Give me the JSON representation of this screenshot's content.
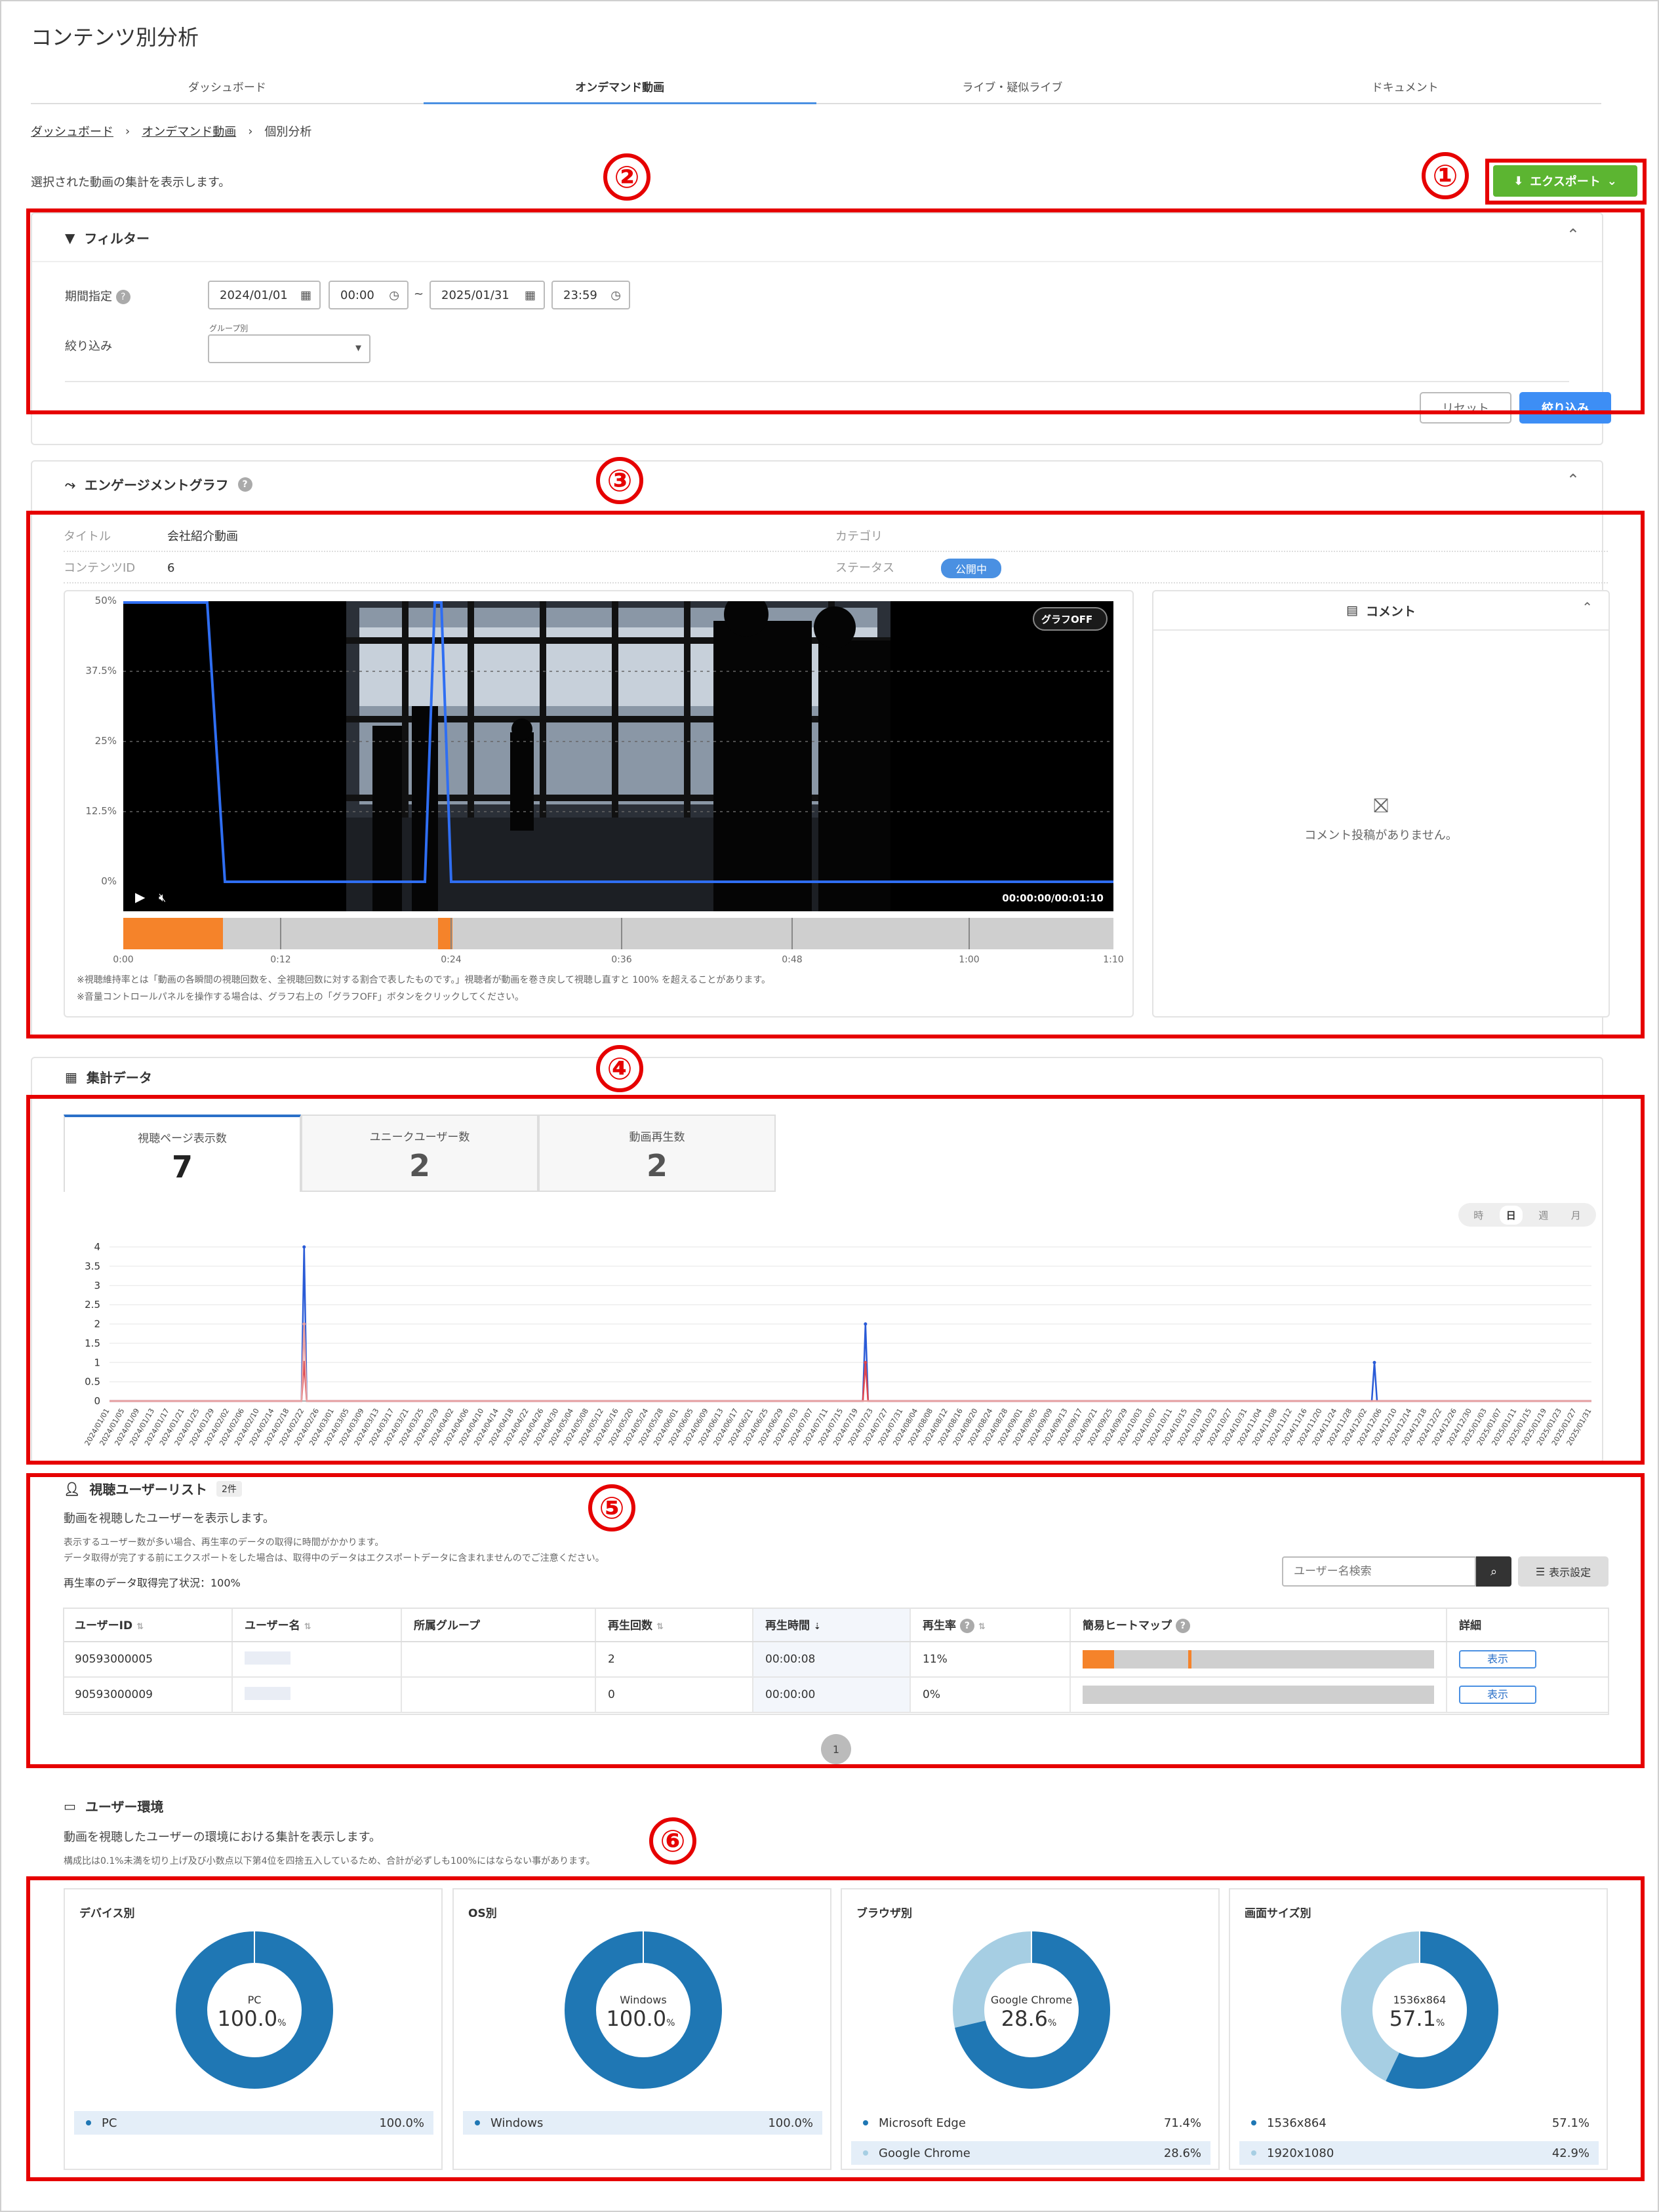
{
  "page": {
    "title": "コンテンツ別分析",
    "description": "選択された動画の集計を表示します。"
  },
  "tabs": [
    {
      "label": "ダッシュボード"
    },
    {
      "label": "オンデマンド動画"
    },
    {
      "label": "ライブ・疑似ライブ"
    },
    {
      "label": "ドキュメント"
    }
  ],
  "breadcrumb": [
    {
      "label": "ダッシュボード"
    },
    {
      "label": "オンデマンド動画"
    },
    {
      "label": "個別分析"
    }
  ],
  "export": {
    "label": "エクスポート"
  },
  "callouts": [
    "①",
    "②",
    "③",
    "④",
    "⑤",
    "⑥"
  ],
  "filter": {
    "title": "フィルター",
    "period_label": "期間指定",
    "start_date": "2024/01/01",
    "start_time": "00:00",
    "tilde": "~",
    "end_date": "2025/01/31",
    "end_time": "23:59",
    "refine_label": "絞り込み",
    "group_label": "グループ別",
    "reset": "リセット",
    "apply": "絞り込み"
  },
  "engagement": {
    "title": "エンゲージメントグラフ",
    "title_key": "タイトル",
    "title_val": "会社紹介動画",
    "category_key": "カテゴリ",
    "id_key": "コンテンツID",
    "id_val": "6",
    "status_key": "ステータス",
    "status_val": "公開中",
    "graph_off": "グラフOFF",
    "time": "00:00:00/00:01:10",
    "yticks": [
      "50%",
      "37.5%",
      "25%",
      "12.5%",
      "0%"
    ],
    "xticks": [
      "0:00",
      "0:12",
      "0:24",
      "0:36",
      "0:48",
      "1:00",
      "1:10"
    ],
    "note1": "※視聴維持率とは「動画の各瞬間の視聴回数を、全視聴回数に対する割合で表したものです。」視聴者が動画を巻き戻して視聴し直すと 100% を超えることがあります。",
    "note2": "※音量コントロールパネルを操作する場合は、グラフ右上の「グラフOFF」ボタンをクリックしてください。",
    "comment_title": "コメント",
    "no_comment": "コメント投稿がありません。"
  },
  "summary": {
    "title": "集計データ",
    "kpis": [
      {
        "label": "視聴ページ表示数",
        "value": "7"
      },
      {
        "label": "ユニークユーザー数",
        "value": "2"
      },
      {
        "label": "動画再生数",
        "value": "2"
      }
    ],
    "intervals": [
      "時",
      "日",
      "週",
      "月"
    ],
    "active_interval": "日"
  },
  "chart_data": {
    "type": "line",
    "ylim": [
      0,
      4
    ],
    "yticks": [
      "4",
      "3.5",
      "3",
      "2.5",
      "2",
      "1.5",
      "1",
      "0.5",
      "0"
    ],
    "x_start": "2024/01/01",
    "x_end": "2025/01/31",
    "x_tick_every_days": 4,
    "series": [
      {
        "color": "#2a5bd7",
        "points": [
          [
            "2024/02/22",
            4
          ],
          [
            "2024/07/21",
            2
          ],
          [
            "2024/12/04",
            1
          ]
        ]
      },
      {
        "color": "#e0464e",
        "points": [
          [
            "2024/02/22",
            1
          ],
          [
            "2024/07/21",
            1
          ]
        ]
      },
      {
        "color": "#e8a0a0",
        "points": [
          [
            "2024/02/22",
            2
          ]
        ]
      }
    ]
  },
  "userlist": {
    "title": "視聴ユーザーリスト",
    "count": "2件",
    "subtitle": "動画を視聴したユーザーを表示します。",
    "note1": "表示するユーザー数が多い場合、再生率のデータの取得に時間がかかります。",
    "note2": "データ取得が完了する前にエクスポートをした場合は、取得中のデータはエクスポートデータに含まれませんのでご注意ください。",
    "status": "再生率のデータ取得完了状況：100%",
    "search_placeholder": "ユーザー名検索",
    "display_settings": "表示設定",
    "columns": [
      "ユーザーID",
      "ユーザー名",
      "所属グループ",
      "再生回数",
      "再生時間",
      "再生率",
      "簡易ヒートマップ",
      "詳細"
    ],
    "rows": [
      {
        "id": "90593000005",
        "name": "",
        "group": "",
        "count": "2",
        "time": "00:00:08",
        "rate": "11%",
        "view": "表示",
        "heat": [
          [
            0,
            0.09
          ],
          [
            0.3,
            0.31
          ]
        ]
      },
      {
        "id": "90593000009",
        "name": "",
        "group": "",
        "count": "0",
        "time": "00:00:00",
        "rate": "0%",
        "view": "表示",
        "heat": []
      }
    ],
    "page": "1"
  },
  "environment": {
    "title": "ユーザー環境",
    "subtitle": "動画を視聴したユーザーの環境における集計を表示します。",
    "note": "構成比は0.1%未満を切り上げ及び小数点以下第4位を四捨五入しているため、合計が必ずしも100%にはならない事があります。",
    "charts": [
      {
        "title": "デバイス別",
        "center_label": "PC",
        "center_value": "100.0",
        "slices": [
          {
            "label": "PC",
            "value": 100.0,
            "pct": "100.0%",
            "color": "#1f77b4"
          }
        ]
      },
      {
        "title": "OS別",
        "center_label": "Windows",
        "center_value": "100.0",
        "slices": [
          {
            "label": "Windows",
            "value": 100.0,
            "pct": "100.0%",
            "color": "#1f77b4"
          }
        ]
      },
      {
        "title": "ブラウザ別",
        "center_label": "Google Chrome",
        "center_value": "28.6",
        "slices": [
          {
            "label": "Microsoft Edge",
            "value": 71.4,
            "pct": "71.4%",
            "color": "#1f77b4"
          },
          {
            "label": "Google Chrome",
            "value": 28.6,
            "pct": "28.6%",
            "color": "#a6cee3"
          }
        ]
      },
      {
        "title": "画面サイズ別",
        "center_label": "1536x864",
        "center_value": "57.1",
        "slices": [
          {
            "label": "1536x864",
            "value": 57.1,
            "pct": "57.1%",
            "color": "#1f77b4"
          },
          {
            "label": "1920x1080",
            "value": 42.9,
            "pct": "42.9%",
            "color": "#a6cee3"
          }
        ]
      }
    ],
    "pct_unit": "%"
  }
}
